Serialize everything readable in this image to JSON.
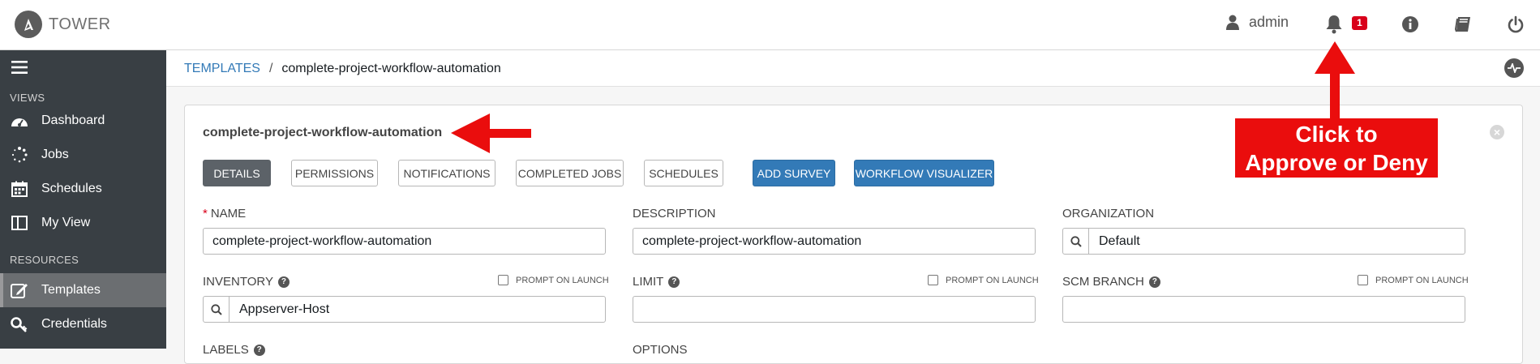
{
  "app": {
    "brand": "TOWER"
  },
  "topbar": {
    "user": "admin",
    "notification_count": "1",
    "icons": [
      "user-icon",
      "bell-icon",
      "info-icon",
      "book-icon",
      "power-icon"
    ]
  },
  "sidebar": {
    "sections": [
      {
        "label": "VIEWS"
      },
      {
        "label": "RESOURCES"
      }
    ],
    "items": [
      {
        "label": "Dashboard",
        "icon": "dashboard-icon"
      },
      {
        "label": "Jobs",
        "icon": "jobs-icon"
      },
      {
        "label": "Schedules",
        "icon": "calendar-icon"
      },
      {
        "label": "My View",
        "icon": "columns-icon"
      },
      {
        "label": "Templates",
        "icon": "templates-icon",
        "active": true
      },
      {
        "label": "Credentials",
        "icon": "key-icon"
      }
    ]
  },
  "breadcrumb": {
    "parent": "TEMPLATES",
    "separator": "/",
    "current": "complete-project-workflow-automation"
  },
  "panel": {
    "title": "complete-project-workflow-automation",
    "close": "×"
  },
  "tabs": [
    {
      "label": "DETAILS",
      "state": "selected"
    },
    {
      "label": "PERMISSIONS"
    },
    {
      "label": "NOTIFICATIONS"
    },
    {
      "label": "COMPLETED JOBS"
    },
    {
      "label": "SCHEDULES"
    },
    {
      "label": "ADD SURVEY",
      "state": "primary"
    },
    {
      "label": "WORKFLOW VISUALIZER",
      "state": "primary"
    }
  ],
  "form": {
    "name": {
      "label": "NAME",
      "required": "*",
      "value": "complete-project-workflow-automation"
    },
    "description": {
      "label": "DESCRIPTION",
      "value": "complete-project-workflow-automation"
    },
    "organization": {
      "label": "ORGANIZATION",
      "value": "Default"
    },
    "inventory": {
      "label": "INVENTORY",
      "value": "Appserver-Host",
      "prompt": "PROMPT ON LAUNCH"
    },
    "limit": {
      "label": "LIMIT",
      "value": "",
      "prompt": "PROMPT ON LAUNCH"
    },
    "scm_branch": {
      "label": "SCM BRANCH",
      "value": "",
      "prompt": "PROMPT ON LAUNCH"
    },
    "labels": {
      "label": "LABELS"
    },
    "options": {
      "label": "OPTIONS"
    },
    "help": "?"
  },
  "annotation": {
    "line1": "Click to",
    "line2": "Approve or Deny",
    "color": "#ea0d0d"
  },
  "colors": {
    "sidebar": "#393f44",
    "primary": "#337ab7",
    "selected_tab": "#5c6268",
    "badge": "#d9001a"
  }
}
